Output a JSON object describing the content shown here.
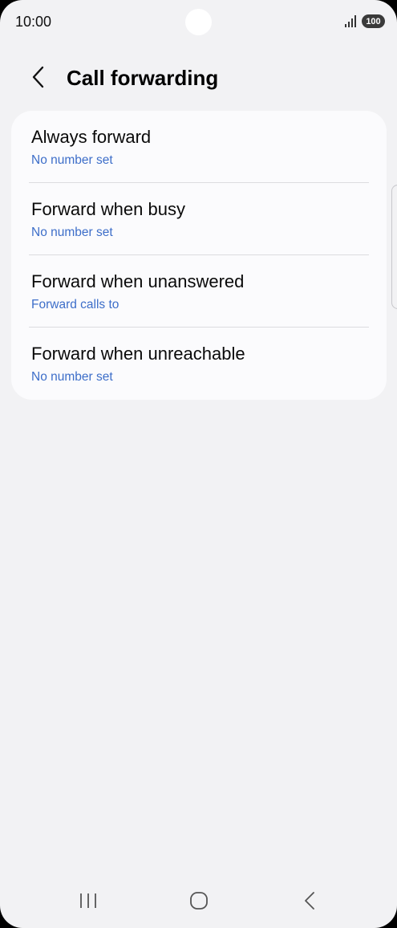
{
  "status_bar": {
    "time": "10:00",
    "battery": "100",
    "icons": [
      "signal-icon",
      "battery-icon"
    ]
  },
  "header": {
    "title": "Call forwarding",
    "back_icon": "chevron-left-icon"
  },
  "forwarding_options": [
    {
      "title": "Always forward",
      "subtitle": "No number set"
    },
    {
      "title": "Forward when busy",
      "subtitle": "No number set"
    },
    {
      "title": "Forward when unanswered",
      "subtitle": "Forward calls to"
    },
    {
      "title": "Forward when unreachable",
      "subtitle": "No number set"
    }
  ],
  "nav_bar": {
    "icons": [
      "recent-apps-icon",
      "home-icon",
      "back-icon"
    ]
  },
  "colors": {
    "background": "#f2f2f4",
    "card": "#fbfbfd",
    "subtitle": "#3d6ec9"
  }
}
